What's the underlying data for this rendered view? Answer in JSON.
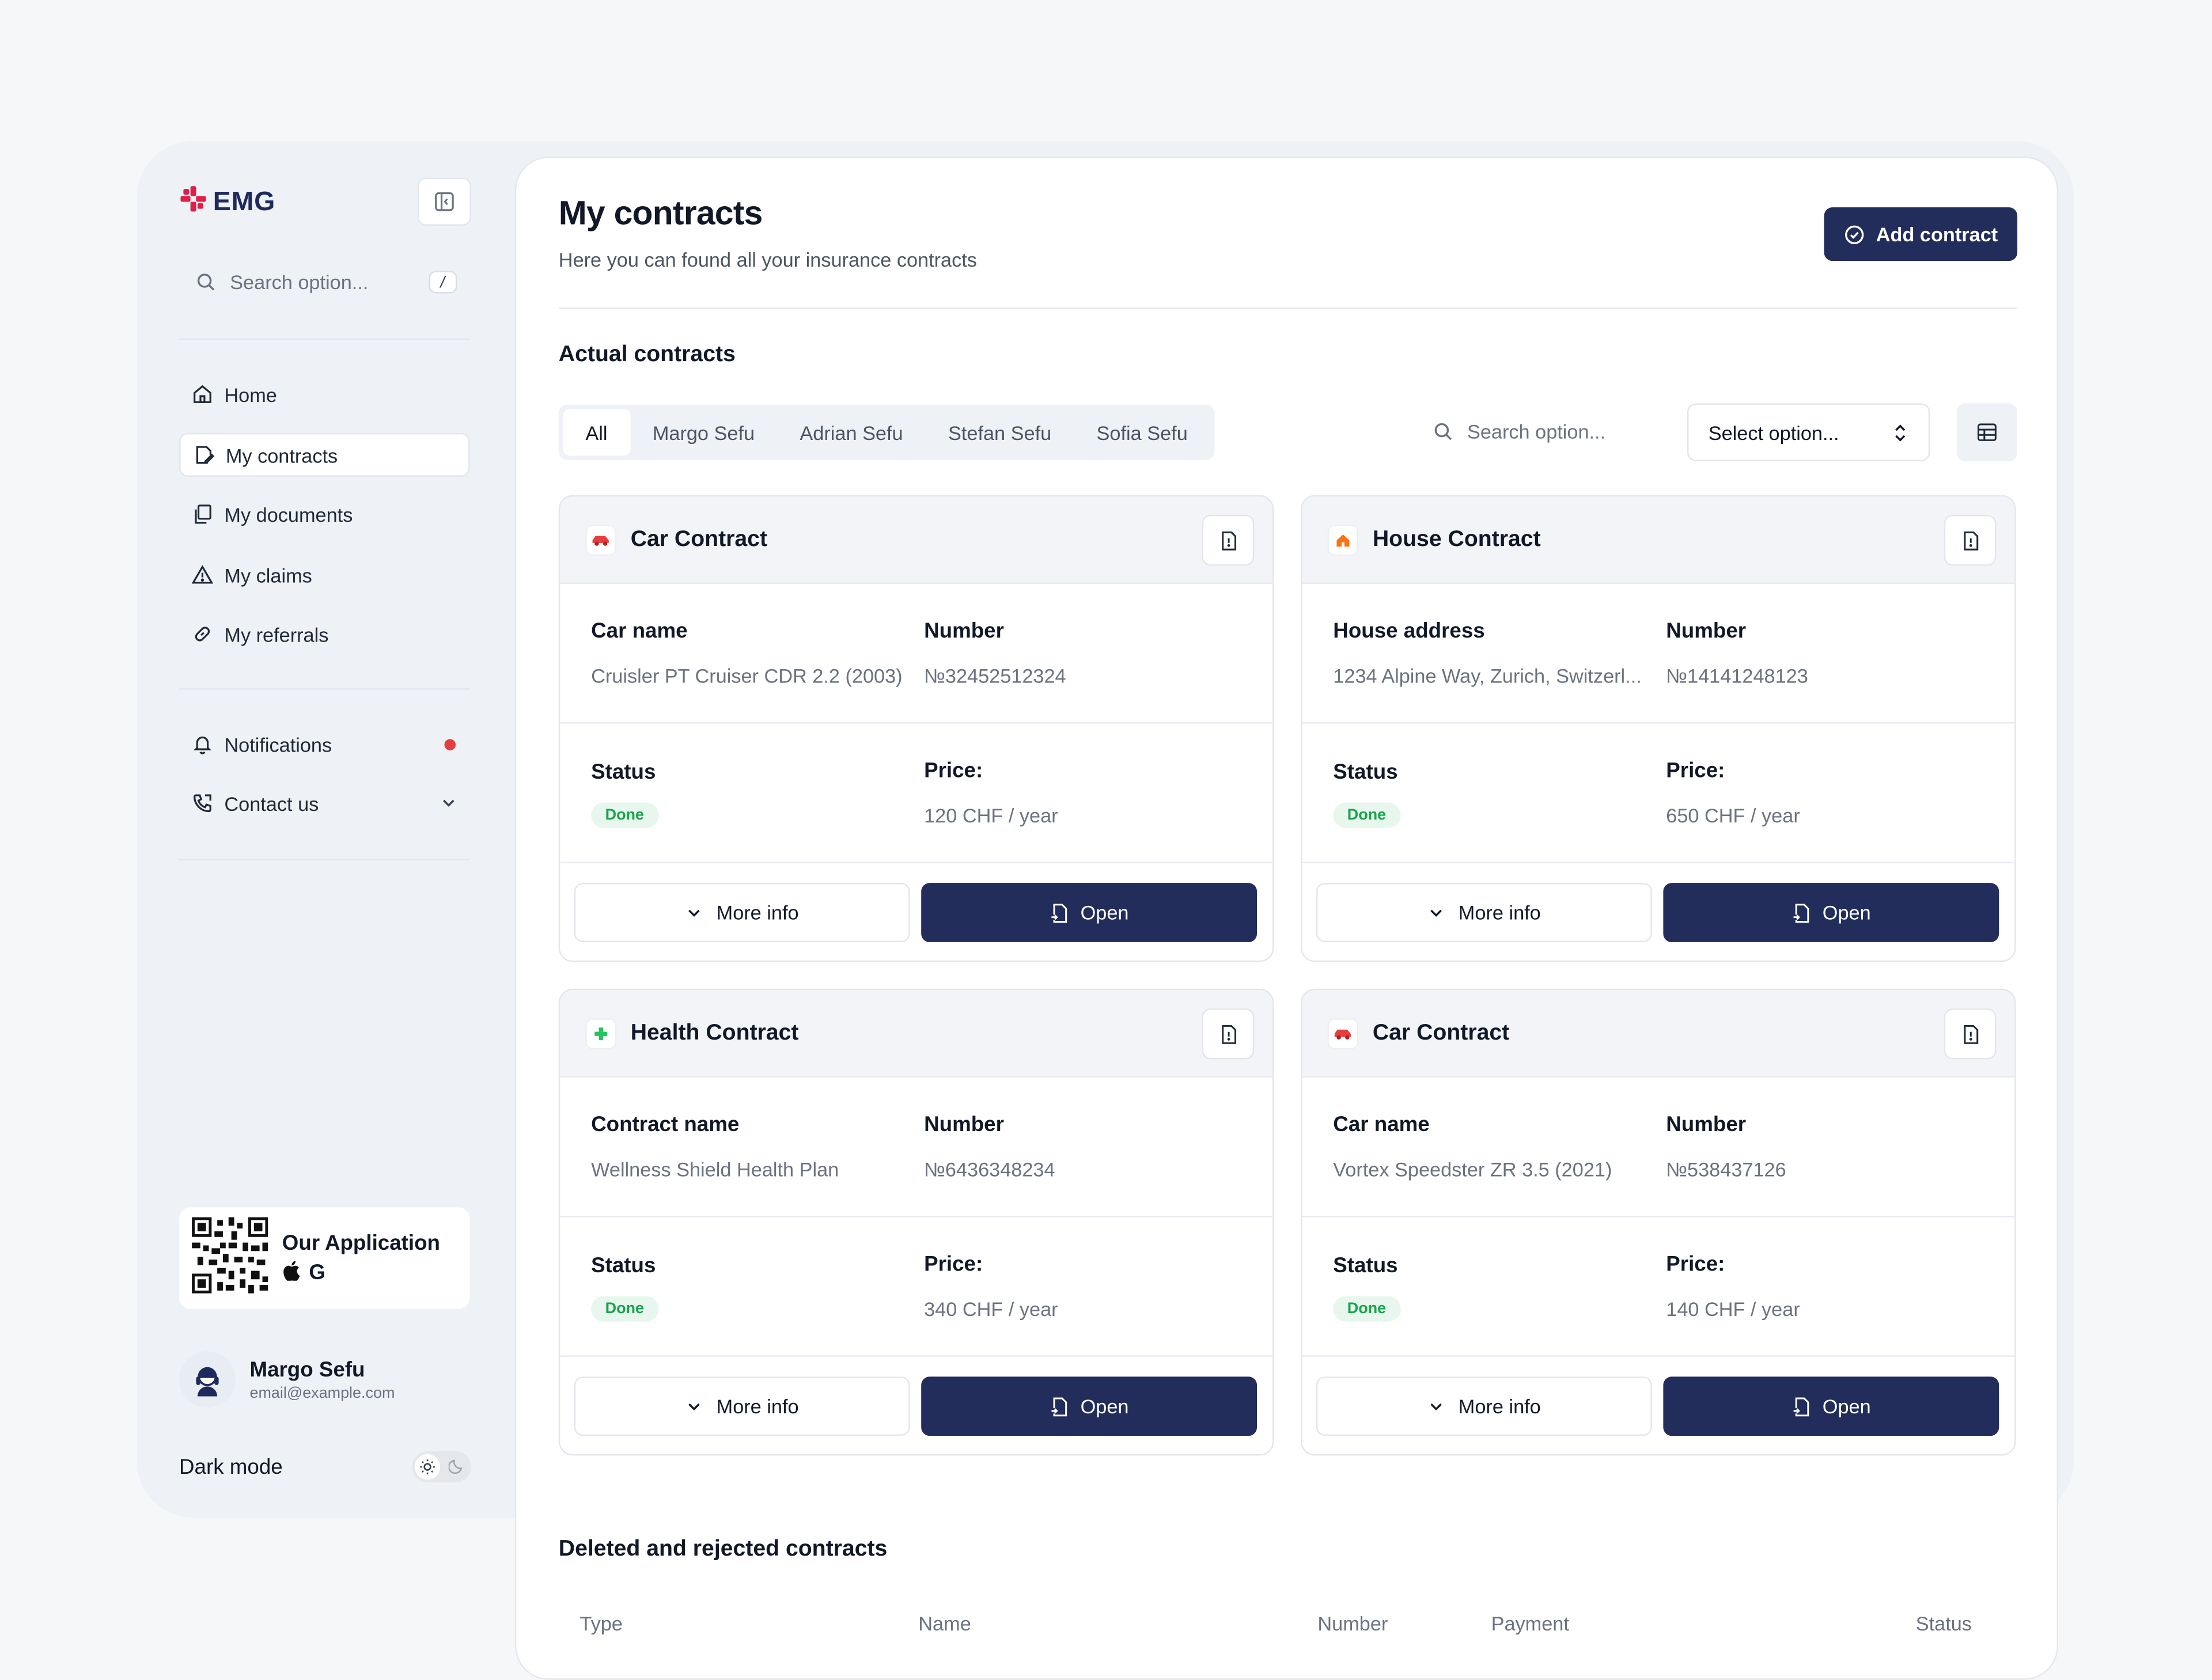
{
  "brand": {
    "name": "EMG",
    "color": "#e11d48"
  },
  "sidebar": {
    "search_placeholder": "Search option...",
    "search_shortcut": "/",
    "nav": [
      {
        "label": "Home",
        "icon": "home-icon"
      },
      {
        "label": "My contracts",
        "icon": "contract-icon",
        "active": true
      },
      {
        "label": "My documents",
        "icon": "documents-icon"
      },
      {
        "label": "My claims",
        "icon": "warning-icon"
      },
      {
        "label": "My referrals",
        "icon": "link-icon"
      }
    ],
    "secondary": [
      {
        "label": "Notifications",
        "icon": "bell-icon"
      },
      {
        "label": "Contact us",
        "icon": "phone-icon"
      }
    ],
    "app_card": {
      "title": "Our Application"
    },
    "user": {
      "name": "Margo Sefu",
      "email": "email@example.com"
    },
    "dark_mode_label": "Dark mode"
  },
  "main": {
    "title": "My contracts",
    "subtitle": "Here you can found all your insurance contracts",
    "add_button": "Add contract",
    "actual_title": "Actual contracts",
    "tabs": [
      "All",
      "Margo Sefu",
      "Adrian Sefu",
      "Stefan Sefu",
      "Sofia Sefu"
    ],
    "search_placeholder": "Search option...",
    "select_placeholder": "Select option...",
    "cards": [
      {
        "title": "Car Contract",
        "type_icon": "car-icon",
        "field1_label": "Car name",
        "field1_value": "Cruisler PT Cruiser CDR 2.2 (2003)",
        "number_label": "Number",
        "number": "№32452512324",
        "status_label": "Status",
        "status": "Done",
        "price_label": "Price:",
        "price": "120 CHF  / year",
        "more": "More info",
        "open": "Open"
      },
      {
        "title": "House Contract",
        "type_icon": "house-icon",
        "field1_label": "House address",
        "field1_value": "1234 Alpine Way, Zurich, Switzerl...",
        "number_label": "Number",
        "number": "№14141248123",
        "status_label": "Status",
        "status": "Done",
        "price_label": "Price:",
        "price": "650 CHF  / year",
        "more": "More info",
        "open": "Open"
      },
      {
        "title": "Health Contract",
        "type_icon": "health-icon",
        "field1_label": "Contract name",
        "field1_value": "Wellness Shield Health Plan",
        "number_label": "Number",
        "number": "№6436348234",
        "status_label": "Status",
        "status": "Done",
        "price_label": "Price:",
        "price": "340 CHF  / year",
        "more": "More info",
        "open": "Open"
      },
      {
        "title": "Car Contract",
        "type_icon": "car-icon",
        "field1_label": "Car name",
        "field1_value": "Vortex Speedster ZR 3.5 (2021)",
        "number_label": "Number",
        "number": "№538437126",
        "status_label": "Status",
        "status": "Done",
        "price_label": "Price:",
        "price": "140 CHF  / year",
        "more": "More info",
        "open": "Open"
      }
    ],
    "deleted_title": "Deleted and rejected contracts",
    "table_headers": [
      "Type",
      "Name",
      "Number",
      "Payment",
      "Status"
    ]
  },
  "colors": {
    "primary": "#222d5c",
    "success": "#16a34a",
    "danger": "#e53e3e"
  }
}
